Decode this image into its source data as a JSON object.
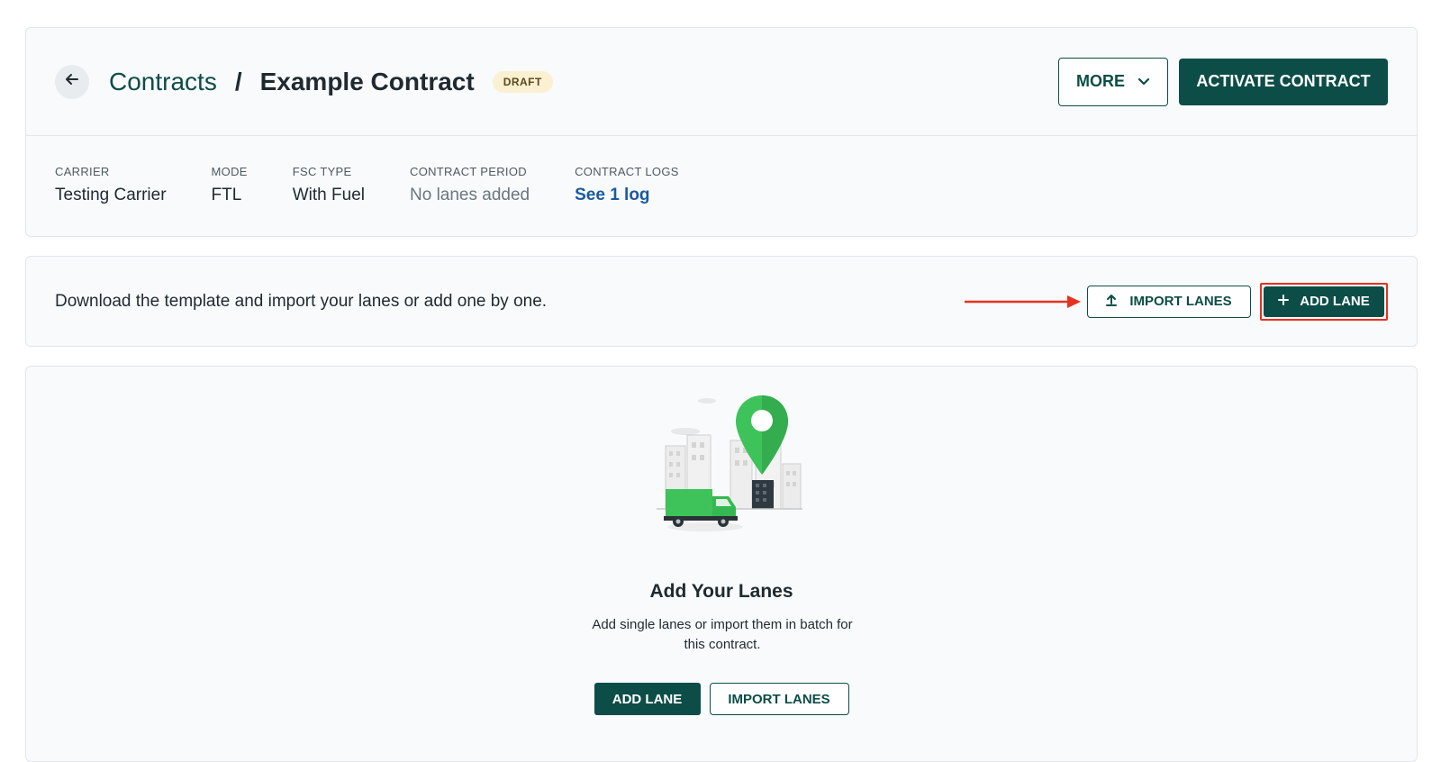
{
  "breadcrumb": {
    "parent": "Contracts",
    "separator": "/",
    "current": "Example Contract",
    "status_badge": "DRAFT"
  },
  "header_actions": {
    "more_label": "MORE",
    "activate_label": "ACTIVATE CONTRACT"
  },
  "meta": [
    {
      "label": "CARRIER",
      "value": "Testing Carrier"
    },
    {
      "label": "MODE",
      "value": "FTL"
    },
    {
      "label": "FSC TYPE",
      "value": "With Fuel"
    },
    {
      "label": "CONTRACT PERIOD",
      "value": "No lanes added"
    },
    {
      "label": "CONTRACT LOGS",
      "value": "See 1 log"
    }
  ],
  "import_strip": {
    "text": "Download the template and import your lanes or add one by one.",
    "import_label": "IMPORT LANES",
    "add_label": "ADD LANE"
  },
  "empty_state": {
    "title": "Add Your Lanes",
    "description": "Add single lanes or import them in batch for this contract.",
    "add_label": "ADD LANE",
    "import_label": "IMPORT LANES"
  },
  "colors": {
    "brand": "#0d4d47",
    "link": "#1a5aa0",
    "annotation": "#e8311e",
    "pin": "#3dc35a"
  },
  "icons": [
    "arrow-left-icon",
    "chevron-down-icon",
    "upload-icon",
    "plus-icon",
    "annotation-arrow-icon",
    "location-pin-icon",
    "truck-icon"
  ]
}
